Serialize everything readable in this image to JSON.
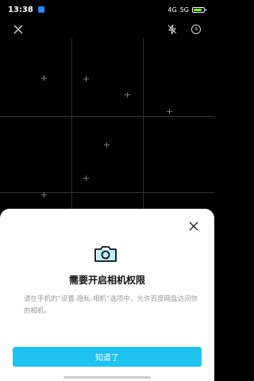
{
  "status_bar": {
    "time": "13:38",
    "signal_text": "4G",
    "network_text": "5G",
    "battery_percent": 80
  },
  "camera": {
    "close_icon": "close-icon",
    "flash_icon": "flash-off-icon",
    "timer_icon": "timer-icon"
  },
  "permission_sheet": {
    "title": "需要开启相机权限",
    "description": "请在手机的“设置-隐私-相机”选项中，允许百度网盘访问你的相机。",
    "confirm_label": "知道了",
    "accent_color": "#1ec3f0"
  }
}
